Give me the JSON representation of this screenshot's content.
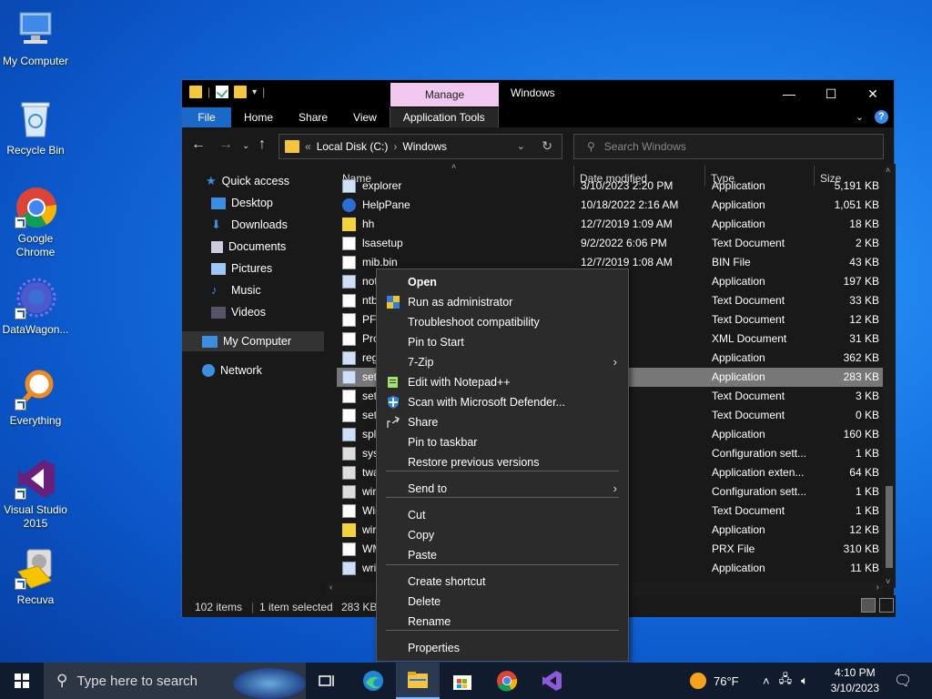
{
  "desktop": {
    "icons": [
      {
        "label": "My Computer"
      },
      {
        "label": "Recycle Bin"
      },
      {
        "label": "Google Chrome"
      },
      {
        "label": "DataWagon..."
      },
      {
        "label": "Everything"
      },
      {
        "label": "Visual Studio 2015"
      },
      {
        "label": "Recuva"
      }
    ]
  },
  "explorer": {
    "title": "Windows",
    "manage_tab": "Manage",
    "ribbon_tabs": [
      "File",
      "Home",
      "Share",
      "View",
      "Application Tools"
    ],
    "address": {
      "crumbs": [
        "Local Disk (C:)",
        "Windows"
      ],
      "prefix": "«"
    },
    "search_placeholder": "Search Windows",
    "nav": {
      "quick_access": "Quick access",
      "items": [
        "Desktop",
        "Downloads",
        "Documents",
        "Pictures",
        "Music",
        "Videos"
      ],
      "my_computer": "My Computer",
      "network": "Network"
    },
    "columns": {
      "name": "Name",
      "date": "Date modified",
      "type": "Type",
      "size": "Size"
    },
    "rows": [
      {
        "name": "explorer",
        "date": "3/10/2023 2:20 PM",
        "type": "Application",
        "size": "5,191 KB",
        "icon": "app"
      },
      {
        "name": "HelpPane",
        "date": "10/18/2022 2:16 AM",
        "type": "Application",
        "size": "1,051 KB",
        "icon": "help"
      },
      {
        "name": "hh",
        "date": "12/7/2019 1:09 AM",
        "type": "Application",
        "size": "18 KB",
        "icon": "warn"
      },
      {
        "name": "lsasetup",
        "date": "9/2/2022 6:06 PM",
        "type": "Text Document",
        "size": "2 KB",
        "icon": "doc"
      },
      {
        "name": "mib.bin",
        "date": "12/7/2019 1:08 AM",
        "type": "BIN File",
        "size": "43 KB",
        "icon": "doc"
      },
      {
        "name": "not",
        "date": ":28 AM",
        "type": "Application",
        "size": "197 KB",
        "icon": "app"
      },
      {
        "name": "ntb",
        "date": ":52 PM",
        "type": "Text Document",
        "size": "33 KB",
        "icon": "doc"
      },
      {
        "name": "PFF",
        "date": "1:58 PM",
        "type": "Text Document",
        "size": "12 KB",
        "icon": "doc"
      },
      {
        "name": "Pro",
        "date": "1:10 AM",
        "type": "XML Document",
        "size": "31 KB",
        "icon": "doc"
      },
      {
        "name": "reg",
        "date": ":27 AM",
        "type": "Application",
        "size": "362 KB",
        "icon": "app"
      },
      {
        "name": "set",
        "date": ":26 AM",
        "type": "Application",
        "size": "283 KB",
        "icon": "app",
        "selected": true
      },
      {
        "name": "set",
        "date": "1:37 AM",
        "type": "Text Document",
        "size": "3 KB",
        "icon": "doc"
      },
      {
        "name": "set",
        "date": "1:37 AM",
        "type": "Text Document",
        "size": "0 KB",
        "icon": "doc"
      },
      {
        "name": "spl",
        "date": "2:26 PM",
        "type": "Application",
        "size": "160 KB",
        "icon": "app"
      },
      {
        "name": "sys",
        "date": "1:12 AM",
        "type": "Configuration sett...",
        "size": "1 KB",
        "icon": "cfg"
      },
      {
        "name": "twa",
        "date": "1:10 AM",
        "type": "Application exten...",
        "size": "64 KB",
        "icon": "cfg"
      },
      {
        "name": "wir",
        "date": "1:12 AM",
        "type": "Configuration sett...",
        "size": "1 KB",
        "icon": "cfg"
      },
      {
        "name": "Wir",
        "date": "4:05 PM",
        "type": "Text Document",
        "size": "1 KB",
        "icon": "doc"
      },
      {
        "name": "wir",
        "date": "1:10 AM",
        "type": "Application",
        "size": "12 KB",
        "icon": "warn"
      },
      {
        "name": "WM",
        "date": "1:53 AM",
        "type": "PRX File",
        "size": "310 KB",
        "icon": "doc"
      },
      {
        "name": "wri",
        "date": "1:29 PM",
        "type": "Application",
        "size": "11 KB",
        "icon": "app"
      }
    ],
    "status": {
      "count": "102 items",
      "selected": "1 item selected",
      "size": "283 KB"
    }
  },
  "context_menu": {
    "items": [
      {
        "label": "Open",
        "bold": true
      },
      {
        "label": "Run as administrator",
        "icon": "shield-icon"
      },
      {
        "label": "Troubleshoot compatibility"
      },
      {
        "label": "Pin to Start"
      },
      {
        "label": "7-Zip",
        "submenu": true
      },
      {
        "label": "Edit with Notepad++",
        "icon": "notepad-icon"
      },
      {
        "label": "Scan with Microsoft Defender...",
        "icon": "defender-icon"
      },
      {
        "label": "Share",
        "icon": "share-icon"
      },
      {
        "label": "Pin to taskbar"
      },
      {
        "label": "Restore previous versions"
      },
      {
        "label": "Send to",
        "submenu": true
      },
      {
        "label": "Cut"
      },
      {
        "label": "Copy"
      },
      {
        "label": "Paste"
      },
      {
        "label": "Create shortcut"
      },
      {
        "label": "Delete"
      },
      {
        "label": "Rename"
      },
      {
        "label": "Properties"
      }
    ]
  },
  "taskbar": {
    "search_placeholder": "Type here to search",
    "weather": "76°F",
    "time": "4:10 PM",
    "date": "3/10/2023"
  },
  "colors": {
    "accent": "#1a68c7",
    "manage_tab": "#f0c8f0",
    "desktop": "#1778e6"
  }
}
